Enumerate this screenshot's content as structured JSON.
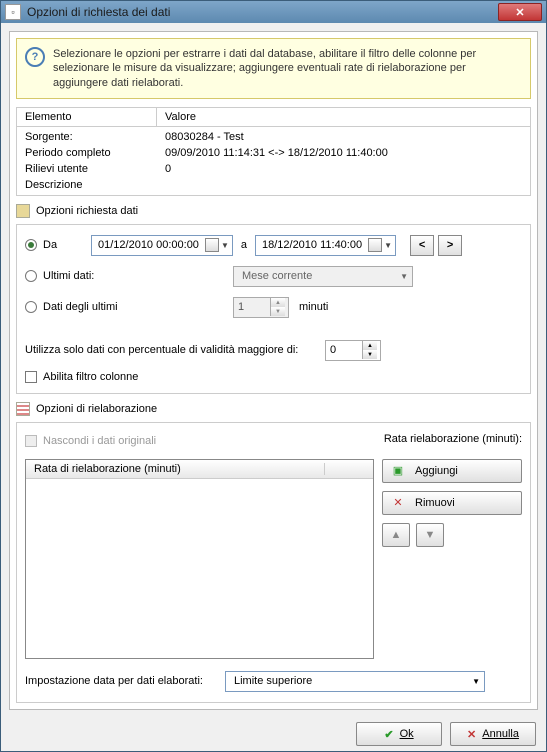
{
  "window": {
    "title": "Opzioni di richiesta dei dati"
  },
  "info": {
    "text": "Selezionare le opzioni per estrarre i dati dal database, abilitare il filtro delle colonne per selezionare le misure da visualizzare; aggiungere eventuali rate di rielaborazione per aggiungere dati rielaborati."
  },
  "summary": {
    "headers": {
      "element": "Elemento",
      "value": "Valore"
    },
    "rows": [
      {
        "label": "Sorgente:",
        "value": "08030284 - Test"
      },
      {
        "label": "Periodo completo",
        "value": "09/09/2010 11:14:31 <-> 18/12/2010 11:40:00"
      },
      {
        "label": "Rilievi utente",
        "value": "0"
      },
      {
        "label": "Descrizione",
        "value": ""
      }
    ]
  },
  "section_request": {
    "title": "Opzioni richiesta dati",
    "opt_da": {
      "label": "Da",
      "from": "01/12/2010 00:00:00",
      "sep": "a",
      "to": "18/12/2010 11:40:00"
    },
    "opt_ultimi": {
      "label": "Ultimi dati:",
      "combo": "Mese corrente"
    },
    "opt_ultimi_n": {
      "label": "Dati degli ultimi",
      "value": "1",
      "unit": "minuti"
    },
    "validity": {
      "label": "Utilizza solo dati con percentuale di validità maggiore di:",
      "value": "0"
    },
    "filter": {
      "label": "Abilita filtro colonne"
    }
  },
  "section_reproc": {
    "title": "Opzioni di rielaborazione",
    "hide": "Nascondi i dati originali",
    "rate_label": "Rata rielaborazione (minuti):",
    "col_header": "Rata di rielaborazione (minuti)",
    "add": "Aggiungi",
    "remove": "Rimuovi",
    "date_setting": {
      "label": "Impostazione data per dati elaborati:",
      "value": "Limite superiore"
    }
  },
  "buttons": {
    "ok": "Ok",
    "cancel": "Annulla"
  }
}
